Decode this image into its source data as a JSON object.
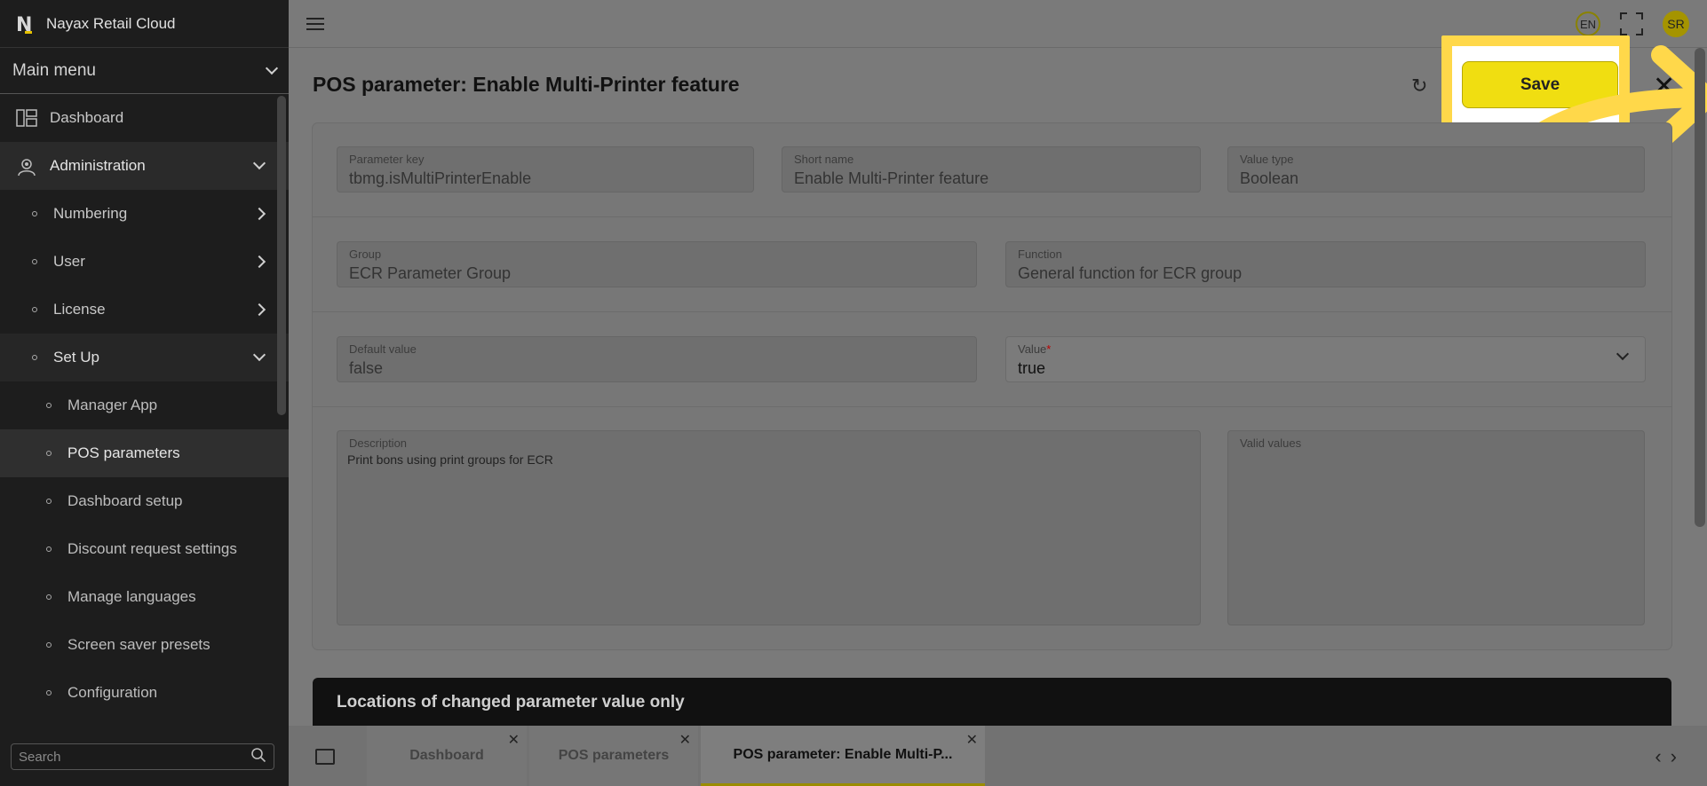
{
  "app": {
    "title": "Nayax Retail Cloud"
  },
  "sidebar": {
    "main_menu": "Main menu",
    "items": [
      {
        "label": "Dashboard"
      },
      {
        "label": "Administration"
      },
      {
        "label": "Numbering"
      },
      {
        "label": "User"
      },
      {
        "label": "License"
      },
      {
        "label": "Set Up"
      },
      {
        "label": "Manager App"
      },
      {
        "label": "POS parameters"
      },
      {
        "label": "Dashboard setup"
      },
      {
        "label": "Discount request settings"
      },
      {
        "label": "Manage languages"
      },
      {
        "label": "Screen saver presets"
      },
      {
        "label": "Configuration"
      }
    ],
    "search_placeholder": "Search"
  },
  "topbar": {
    "language": "EN",
    "avatar": "SR"
  },
  "page": {
    "title": "POS parameter: Enable Multi-Printer feature",
    "save_label": "Save"
  },
  "form": {
    "parameter_key": {
      "label": "Parameter key",
      "value": "tbmg.isMultiPrinterEnable"
    },
    "short_name": {
      "label": "Short name",
      "value": "Enable Multi-Printer feature"
    },
    "value_type": {
      "label": "Value type",
      "value": "Boolean"
    },
    "group": {
      "label": "Group",
      "value": "ECR Parameter Group"
    },
    "function": {
      "label": "Function",
      "value": "General function for ECR group"
    },
    "default_value": {
      "label": "Default value",
      "value": "false"
    },
    "value": {
      "label": "Value",
      "required": "*",
      "value": "true"
    },
    "description": {
      "label": "Description",
      "value": "Print bons using print groups for ECR"
    },
    "valid_values": {
      "label": "Valid values",
      "value": ""
    }
  },
  "locations": {
    "title": "Locations of changed parameter value only"
  },
  "tabs": [
    {
      "label": "Dashboard"
    },
    {
      "label": "POS parameters"
    },
    {
      "label": "POS parameter: Enable Multi-P..."
    }
  ],
  "colors": {
    "accent": "#f0de11",
    "highlight": "#ffd84a"
  }
}
